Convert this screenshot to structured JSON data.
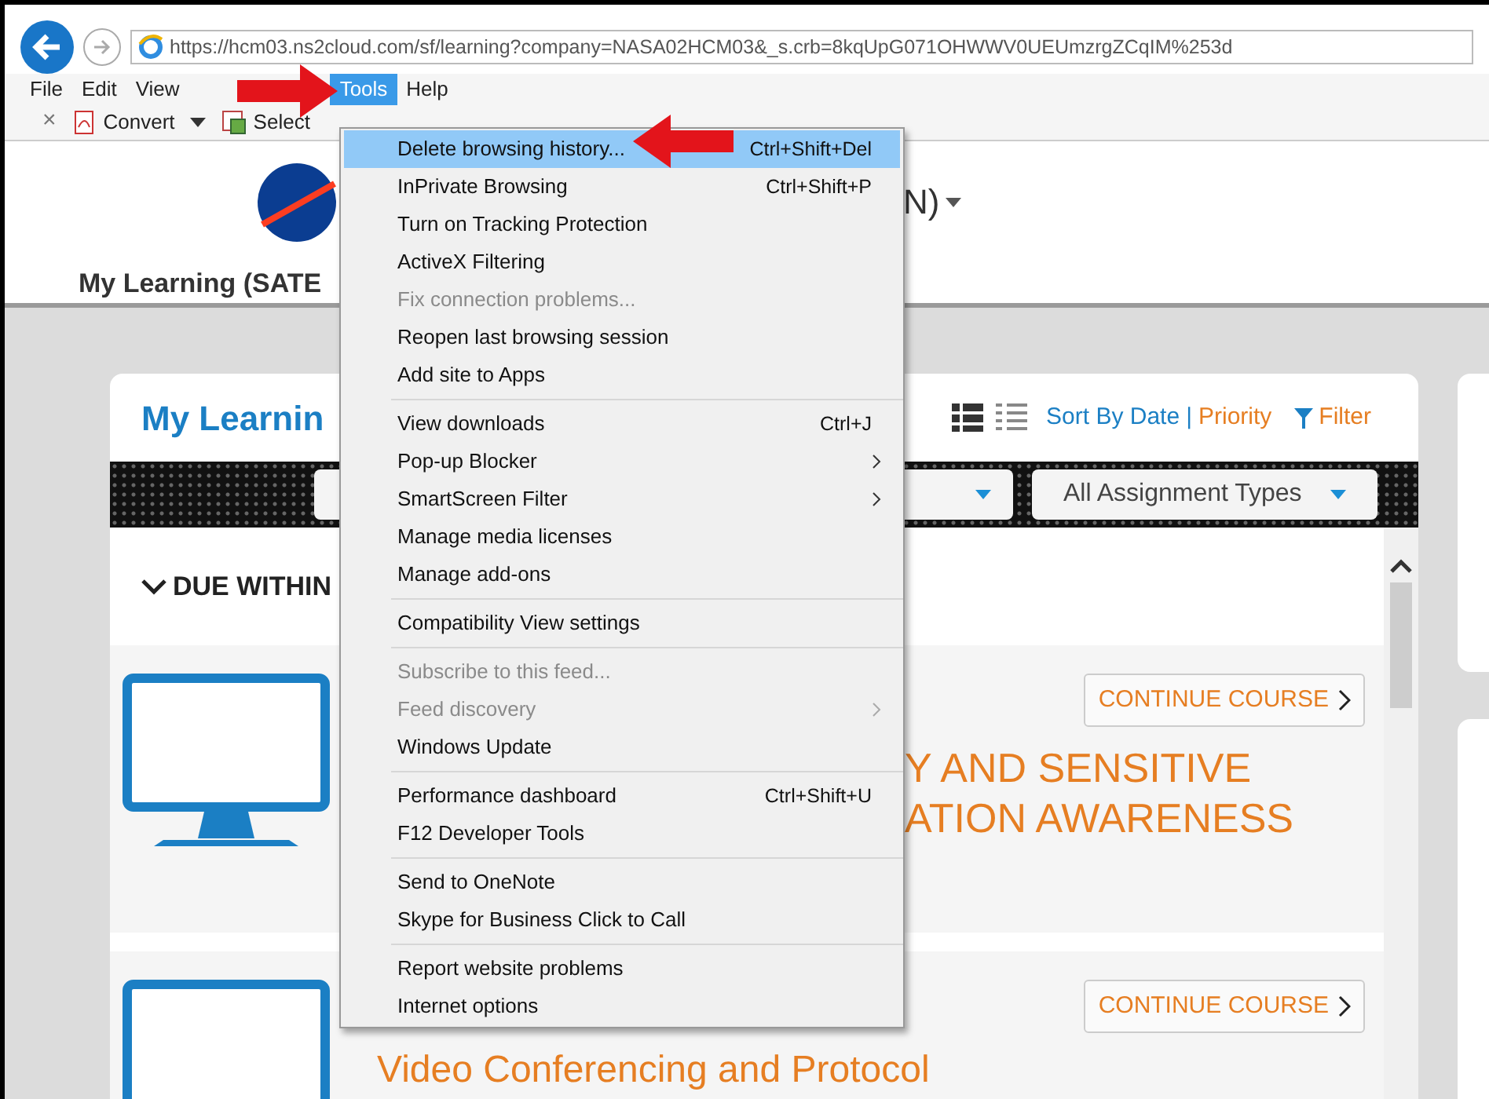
{
  "address_bar": {
    "url": "https://hcm03.ns2cloud.com/sf/learning?company=NASA02HCM03&_s.crb=8kqUpG071OHWWV0UEUmzrgZCqIM%253d"
  },
  "menu_bar": [
    {
      "label": "File",
      "selected": false
    },
    {
      "label": "Edit",
      "selected": false
    },
    {
      "label": "View",
      "selected": false
    },
    {
      "label": "Tools",
      "selected": true
    },
    {
      "label": "Help",
      "selected": false
    }
  ],
  "command_bar": [
    {
      "kind": "close",
      "label": "×"
    },
    {
      "kind": "convert",
      "label": "Convert"
    },
    {
      "kind": "caret"
    },
    {
      "kind": "select",
      "label": "Select"
    }
  ],
  "page_header": {
    "user_suffix": "N)",
    "page_title": "My Learning (SATE"
  },
  "card": {
    "title": "My Learnin",
    "sort_label": "Sort By Date",
    "separator": "|",
    "priority_label": "Priority",
    "filter_label": "Filter",
    "assignment_filter": "All Assignment Types",
    "section": "DUE WITHIN"
  },
  "courses": [
    {
      "title_lines": [
        "Y AND SENSITIVE",
        "ATION AWARENESS"
      ],
      "button": "CONTINUE COURSE"
    },
    {
      "title_lines": [
        "Video Conferencing and Protocol"
      ],
      "button": "CONTINUE COURSE"
    }
  ],
  "tools_menu": [
    [
      {
        "label": "Delete browsing history...",
        "shortcut": "Ctrl+Shift+Del",
        "selected": true,
        "disabled": false,
        "submenu": false
      },
      {
        "label": "InPrivate Browsing",
        "shortcut": "Ctrl+Shift+P",
        "selected": false,
        "disabled": false,
        "submenu": false
      },
      {
        "label": "Turn on Tracking Protection",
        "selected": false,
        "disabled": false,
        "submenu": false
      },
      {
        "label": "ActiveX Filtering",
        "selected": false,
        "disabled": false,
        "submenu": false
      },
      {
        "label": "Fix connection problems...",
        "selected": false,
        "disabled": true,
        "submenu": false
      },
      {
        "label": "Reopen last browsing session",
        "selected": false,
        "disabled": false,
        "submenu": false
      },
      {
        "label": "Add site to Apps",
        "selected": false,
        "disabled": false,
        "submenu": false
      }
    ],
    [
      {
        "label": "View downloads",
        "shortcut": "Ctrl+J",
        "selected": false,
        "disabled": false,
        "submenu": false
      },
      {
        "label": "Pop-up Blocker",
        "selected": false,
        "disabled": false,
        "submenu": true
      },
      {
        "label": "SmartScreen Filter",
        "selected": false,
        "disabled": false,
        "submenu": true
      },
      {
        "label": "Manage media licenses",
        "selected": false,
        "disabled": false,
        "submenu": false
      },
      {
        "label": "Manage add-ons",
        "selected": false,
        "disabled": false,
        "submenu": false
      }
    ],
    [
      {
        "label": "Compatibility View settings",
        "selected": false,
        "disabled": false,
        "submenu": false
      }
    ],
    [
      {
        "label": "Subscribe to this feed...",
        "selected": false,
        "disabled": true,
        "submenu": false
      },
      {
        "label": "Feed discovery",
        "selected": false,
        "disabled": true,
        "submenu": true
      },
      {
        "label": "Windows Update",
        "selected": false,
        "disabled": false,
        "submenu": false
      }
    ],
    [
      {
        "label": "Performance dashboard",
        "shortcut": "Ctrl+Shift+U",
        "selected": false,
        "disabled": false,
        "submenu": false
      },
      {
        "label": "F12 Developer Tools",
        "selected": false,
        "disabled": false,
        "submenu": false
      }
    ],
    [
      {
        "label": "Send to OneNote",
        "selected": false,
        "disabled": false,
        "submenu": false
      },
      {
        "label": "Skype for Business Click to Call",
        "selected": false,
        "disabled": false,
        "submenu": false
      }
    ],
    [
      {
        "label": "Report website problems",
        "selected": false,
        "disabled": false,
        "submenu": false
      },
      {
        "label": "Internet options",
        "selected": false,
        "disabled": false,
        "submenu": false
      }
    ]
  ]
}
